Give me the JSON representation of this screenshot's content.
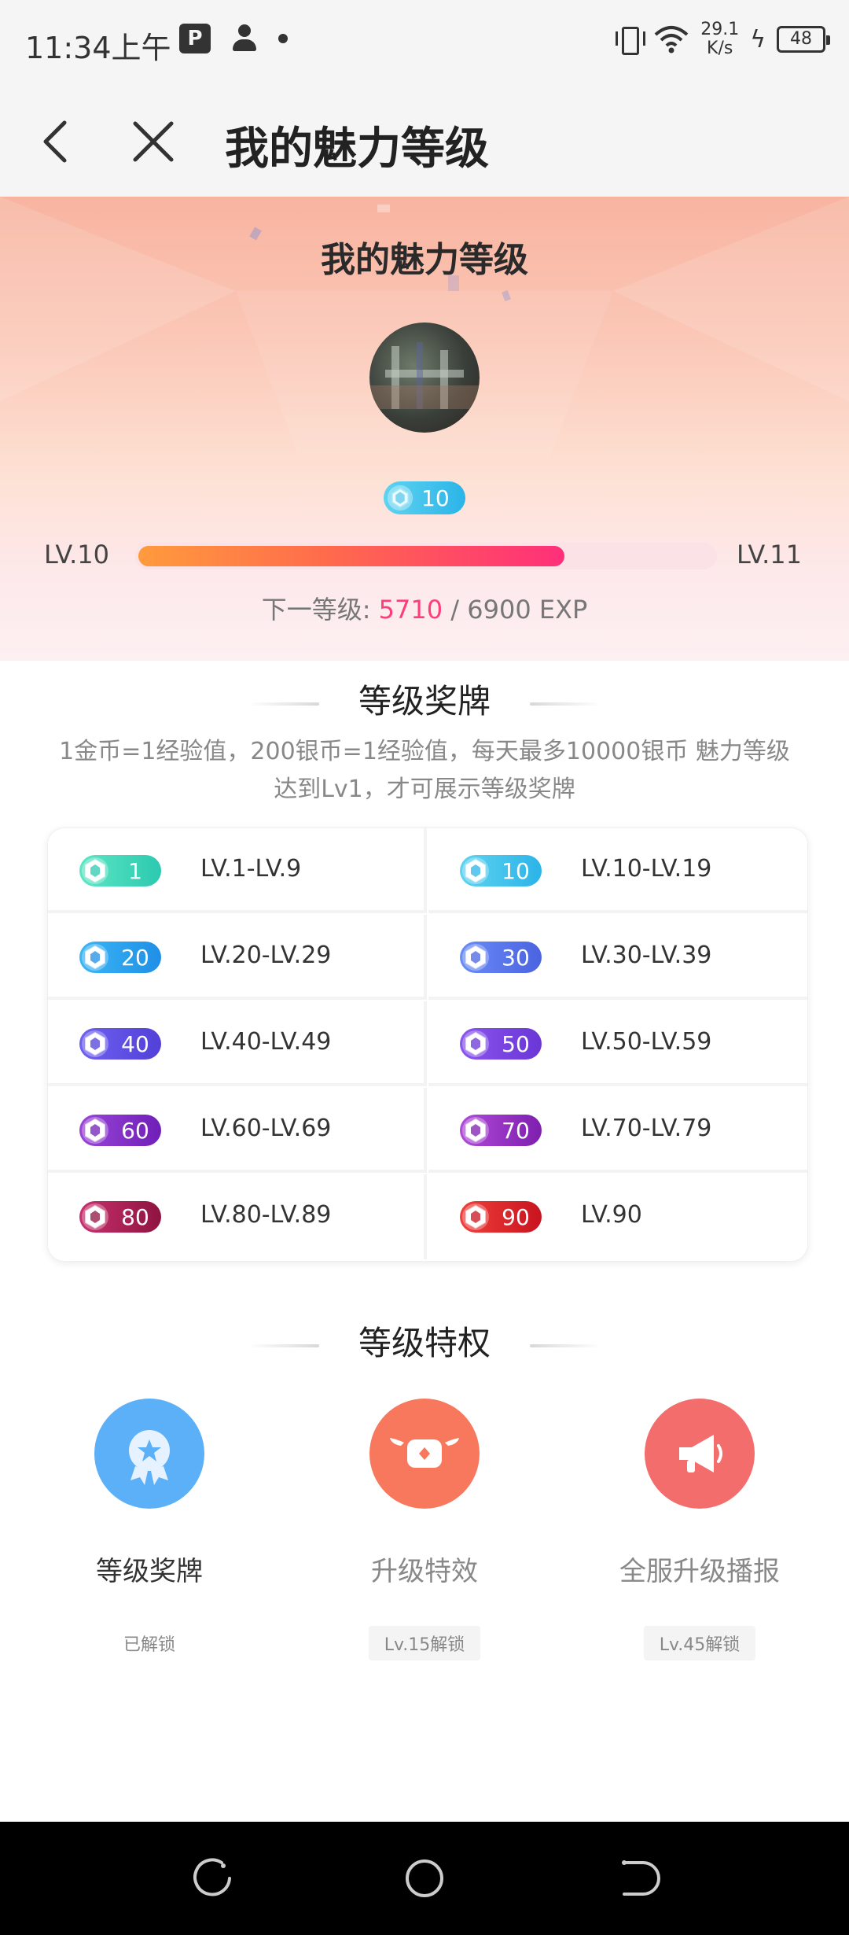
{
  "status_bar": {
    "time": "11:34上午",
    "app_icon": "P",
    "net_speed_value": "29.1",
    "net_speed_unit": "K/s",
    "battery": "48"
  },
  "appbar": {
    "title": "我的魅力等级"
  },
  "hero": {
    "title": "我的魅力等级",
    "badge_level": "10",
    "level_current": "LV.10",
    "level_next": "LV.11",
    "next_label": "下一等级: ",
    "exp_current": "5710",
    "exp_rest": " / 6900 EXP",
    "progress": 0.83
  },
  "medals_section": {
    "title": "等级奖牌",
    "description_line1": "1金币=1经验值，200银币=1经验值，每天最多10000银币 魅力等级",
    "description_line2": "达到Lv1，才可展示等级奖牌",
    "items": [
      {
        "badge": "1",
        "range": "LV.1-LV.9",
        "color1": "#5ee6c4",
        "color2": "#2cc9b0"
      },
      {
        "badge": "10",
        "range": "LV.10-LV.19",
        "color1": "#5fd3f0",
        "color2": "#2bb4e8"
      },
      {
        "badge": "20",
        "range": "LV.20-LV.29",
        "color1": "#3bb6f5",
        "color2": "#1f8fe6"
      },
      {
        "badge": "30",
        "range": "LV.30-LV.39",
        "color1": "#6a8cf7",
        "color2": "#4b63e0"
      },
      {
        "badge": "40",
        "range": "LV.40-LV.49",
        "color1": "#6f60f0",
        "color2": "#5240d8"
      },
      {
        "badge": "50",
        "range": "LV.50-LV.59",
        "color1": "#8a55ee",
        "color2": "#6a36d6"
      },
      {
        "badge": "60",
        "range": "LV.60-LV.69",
        "color1": "#9a45d8",
        "color2": "#6f1fb8"
      },
      {
        "badge": "70",
        "range": "LV.70-LV.79",
        "color1": "#b04ad8",
        "color2": "#7e1fae"
      },
      {
        "badge": "80",
        "range": "LV.80-LV.89",
        "color1": "#c8306e",
        "color2": "#8e1440"
      },
      {
        "badge": "90",
        "range": "LV.90",
        "color1": "#f0403a",
        "color2": "#c8141f"
      }
    ]
  },
  "privileges_section": {
    "title": "等级特权",
    "items": [
      {
        "name": "等级奖牌",
        "status": "已解锁",
        "icon": "medal-icon",
        "color": "#5bb0f7",
        "name_color": "#333333",
        "status_bg": "#ffffff"
      },
      {
        "name": "升级特效",
        "status": "Lv.15解锁",
        "icon": "effect-icon",
        "color": "#f7785c",
        "name_color": "#888888",
        "status_bg": "#f4f4f4"
      },
      {
        "name": "全服升级播报",
        "status": "Lv.45解锁",
        "icon": "megaphone-icon",
        "color": "#f46d6d",
        "name_color": "#888888",
        "status_bg": "#f4f4f4"
      }
    ]
  }
}
